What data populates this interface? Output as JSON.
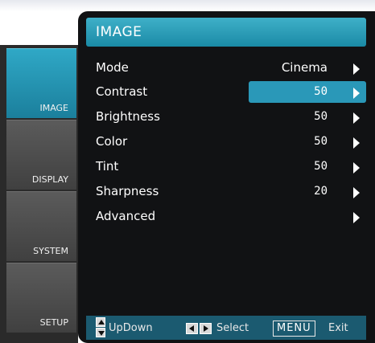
{
  "header": {
    "title": "IMAGE"
  },
  "sidebar": {
    "tabs": [
      {
        "label": "IMAGE",
        "active": true
      },
      {
        "label": "DISPLAY",
        "active": false
      },
      {
        "label": "SYSTEM",
        "active": false
      },
      {
        "label": "SETUP",
        "active": false
      }
    ]
  },
  "menu": {
    "items": [
      {
        "label": "Mode",
        "value": "Cinema"
      },
      {
        "label": "Contrast",
        "value": "50",
        "selected": true
      },
      {
        "label": "Brightness",
        "value": "50"
      },
      {
        "label": "Color",
        "value": "50"
      },
      {
        "label": "Tint",
        "value": "50"
      },
      {
        "label": "Sharpness",
        "value": "20"
      },
      {
        "label": "Advanced",
        "value": ""
      }
    ]
  },
  "footer": {
    "updown_label": "UpDown",
    "select_label": "Select",
    "menu_key": "MENU",
    "exit_label": "Exit"
  },
  "colors": {
    "accent": "#2a98b8",
    "background": "#111214",
    "sidebar_tab": "#4a4a4a",
    "footer": "#1b5a70"
  }
}
